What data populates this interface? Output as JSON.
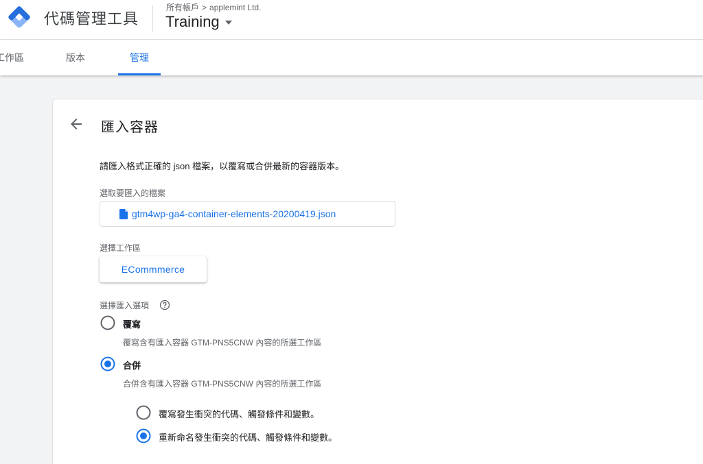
{
  "header": {
    "product_name": "代碼管理工具",
    "breadcrumb": {
      "all_accounts": "所有帳戶",
      "separator": ">",
      "account": "applemint Ltd."
    },
    "container_name": "Training"
  },
  "tabs": [
    {
      "label": "工作區",
      "active": false
    },
    {
      "label": "版本",
      "active": false
    },
    {
      "label": "管理",
      "active": true
    }
  ],
  "page": {
    "title": "匯入容器",
    "intro": "請匯入格式正確的 json 檔案，以覆寫或合併最新的容器版本。",
    "file_label": "選取要匯入的檔案",
    "file_name": "gtm4wp-ga4-container-elements-20200419.json",
    "workspace_label": "選擇工作區",
    "workspace_value": "ECommmerce",
    "import_option_label": "選擇匯入選項",
    "options": [
      {
        "label": "覆寫",
        "description": "覆寫含有匯入容器 GTM-PNS5CNW 內容的所選工作區",
        "selected": false
      },
      {
        "label": "合併",
        "description": "合併含有匯入容器 GTM-PNS5CNW 內容的所選工作區",
        "selected": true
      }
    ],
    "merge_options": [
      {
        "label": "覆寫發生衝突的代碼、觸發條件和變數。",
        "selected": false
      },
      {
        "label": "重新命名發生衝突的代碼、觸發條件和變數。",
        "selected": true
      }
    ]
  },
  "colors": {
    "accent": "#1a73e8",
    "logo_dark": "#246fdb",
    "logo_light": "#8ab4f8"
  }
}
